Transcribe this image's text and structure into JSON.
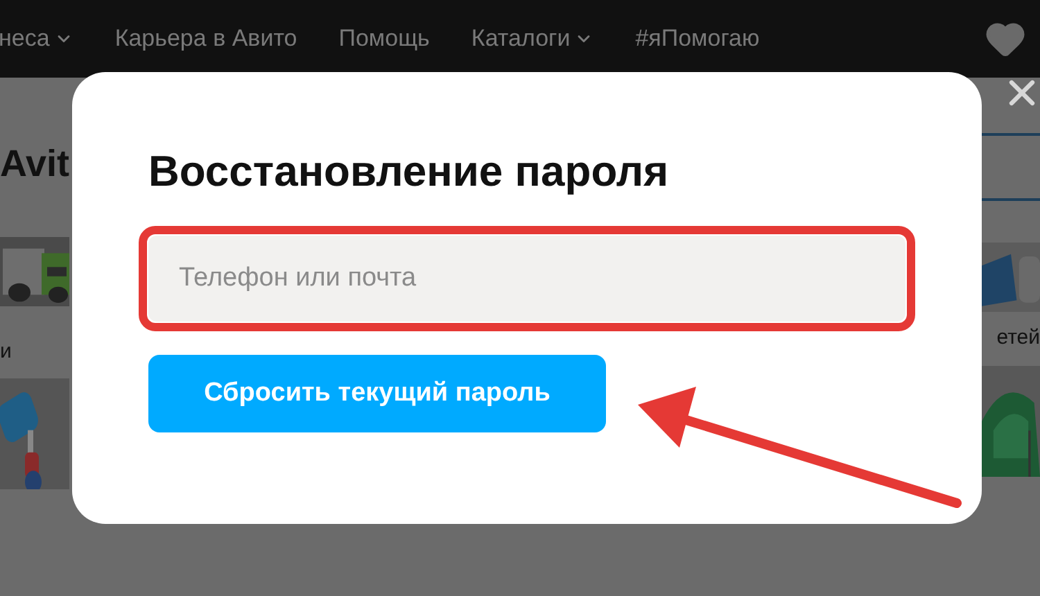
{
  "nav": {
    "items": [
      {
        "label": "неса",
        "kind": "dropdown"
      },
      {
        "label": "Карьера в Авито",
        "kind": "link"
      },
      {
        "label": "Помощь",
        "kind": "link"
      },
      {
        "label": "Каталоги",
        "kind": "dropdown"
      },
      {
        "label": "#яПомогаю",
        "kind": "link"
      }
    ]
  },
  "page": {
    "heading": "Avit",
    "left_caption": "и",
    "right_caption": "етей"
  },
  "modal": {
    "title": "Восстановление пароля",
    "field": {
      "placeholder": "Телефон или почта"
    },
    "button": "Сбросить текущий пароль"
  }
}
